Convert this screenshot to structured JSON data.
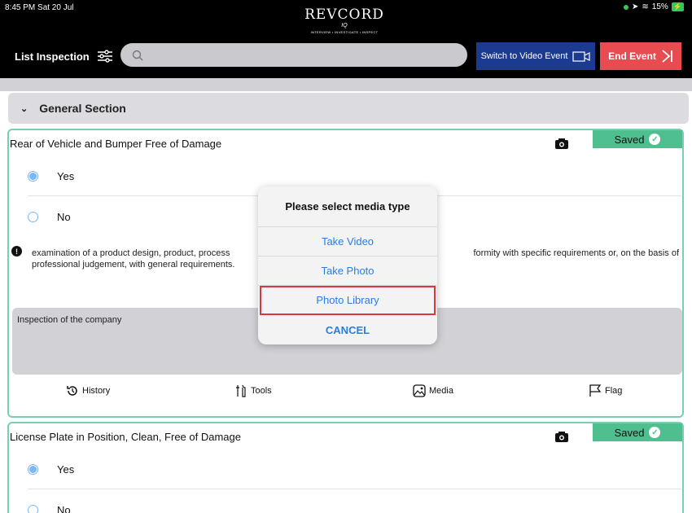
{
  "status_bar": {
    "time": "8:45 PM  Sat 20 Jul",
    "battery": "15%"
  },
  "header": {
    "logo_text": "REVCORD",
    "logo_signature": "IQ",
    "logo_tagline": "INTERVIEW • INVESTIGATE • INSPECT",
    "title": "List Inspection",
    "search_placeholder": "",
    "switch_video_label": "Switch to Video Event",
    "end_event_label": "End Event"
  },
  "section": {
    "title": "General Section"
  },
  "questions": [
    {
      "title": "Rear of Vehicle and Bumper Free of Damage",
      "status": "Saved",
      "options": [
        {
          "label": "Yes",
          "selected": true
        },
        {
          "label": "No",
          "selected": false
        }
      ],
      "info_line1_left": "examination of a product design, product, process",
      "info_line1_right": "formity with specific requirements or, on the basis of",
      "info_line2": "professional judgement, with general requirements.",
      "comment": "Inspection of the company",
      "actions": {
        "history": "History",
        "tools": "Tools",
        "media": "Media",
        "flag": "Flag"
      }
    },
    {
      "title": "License Plate in Position, Clean, Free of Damage",
      "status": "Saved",
      "options": [
        {
          "label": "Yes",
          "selected": true
        },
        {
          "label": "No",
          "selected": false
        }
      ]
    }
  ],
  "modal": {
    "title": "Please select media type",
    "options": [
      "Take Video",
      "Take Photo",
      "Photo Library"
    ],
    "highlighted_option": "Photo Library",
    "cancel": "CANCEL"
  },
  "colors": {
    "saved": "#4fbf8f",
    "switch_video": "#1c3a8f",
    "end_event": "#e84b50",
    "link": "#2a7de1",
    "highlight": "#d9363e"
  }
}
